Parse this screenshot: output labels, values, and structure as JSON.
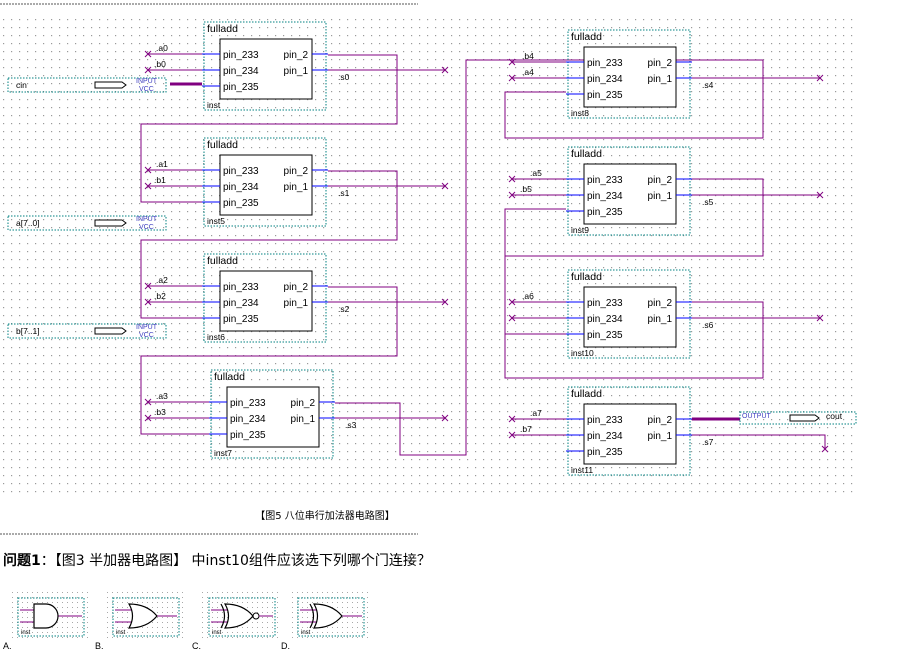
{
  "caption": "【图5 八位串行加法器电路图】",
  "question": {
    "label": "问题1",
    "sep": "：",
    "text": "【图3  半加器电路图】 中inst10组件应该选下列哪个门连接？"
  },
  "block_title": "fulladd",
  "pins": {
    "in1": "pin_233",
    "in2": "pin_234",
    "in3": "pin_235",
    "out1": "pin_2",
    "out2": "pin_1"
  },
  "instances": [
    "inst",
    "inst5",
    "inst6",
    "inst7",
    "inst8",
    "inst9",
    "inst10",
    "inst11"
  ],
  "net_labels": {
    "a": [
      ".a0",
      ".a1",
      ".a2",
      ".a3",
      ".a4",
      ".a5",
      ".a6",
      ".a7"
    ],
    "b": [
      ".b0",
      ".b1",
      ".b2",
      ".b3",
      ".b4",
      ".b5",
      ".b6",
      ".b7"
    ],
    "s": [
      ".s0",
      ".s1",
      ".s2",
      ".s3",
      ".s4",
      ".s5",
      ".s6",
      ".s7"
    ]
  },
  "io": {
    "cin": "cin",
    "a_bus": "a[7..0]",
    "b_bus": "b[7..1]",
    "cout": "cout",
    "input": "INPUT",
    "vcc": "VCC",
    "output": "OUTPUT"
  },
  "options": [
    {
      "label": "A.",
      "gate": "and-gate-icon",
      "inst": "inst"
    },
    {
      "label": "B.",
      "gate": "or-gate-icon",
      "inst": "inst"
    },
    {
      "label": "C.",
      "gate": "xnor-gate-icon",
      "inst": "inst"
    },
    {
      "label": "D.",
      "gate": "xor-gate-icon",
      "inst": "inst"
    }
  ],
  "colors": {
    "wire": "#800080",
    "pin_line": "#0000ff",
    "block_border": "#008080",
    "grid_dot": "#9a9a9a"
  }
}
